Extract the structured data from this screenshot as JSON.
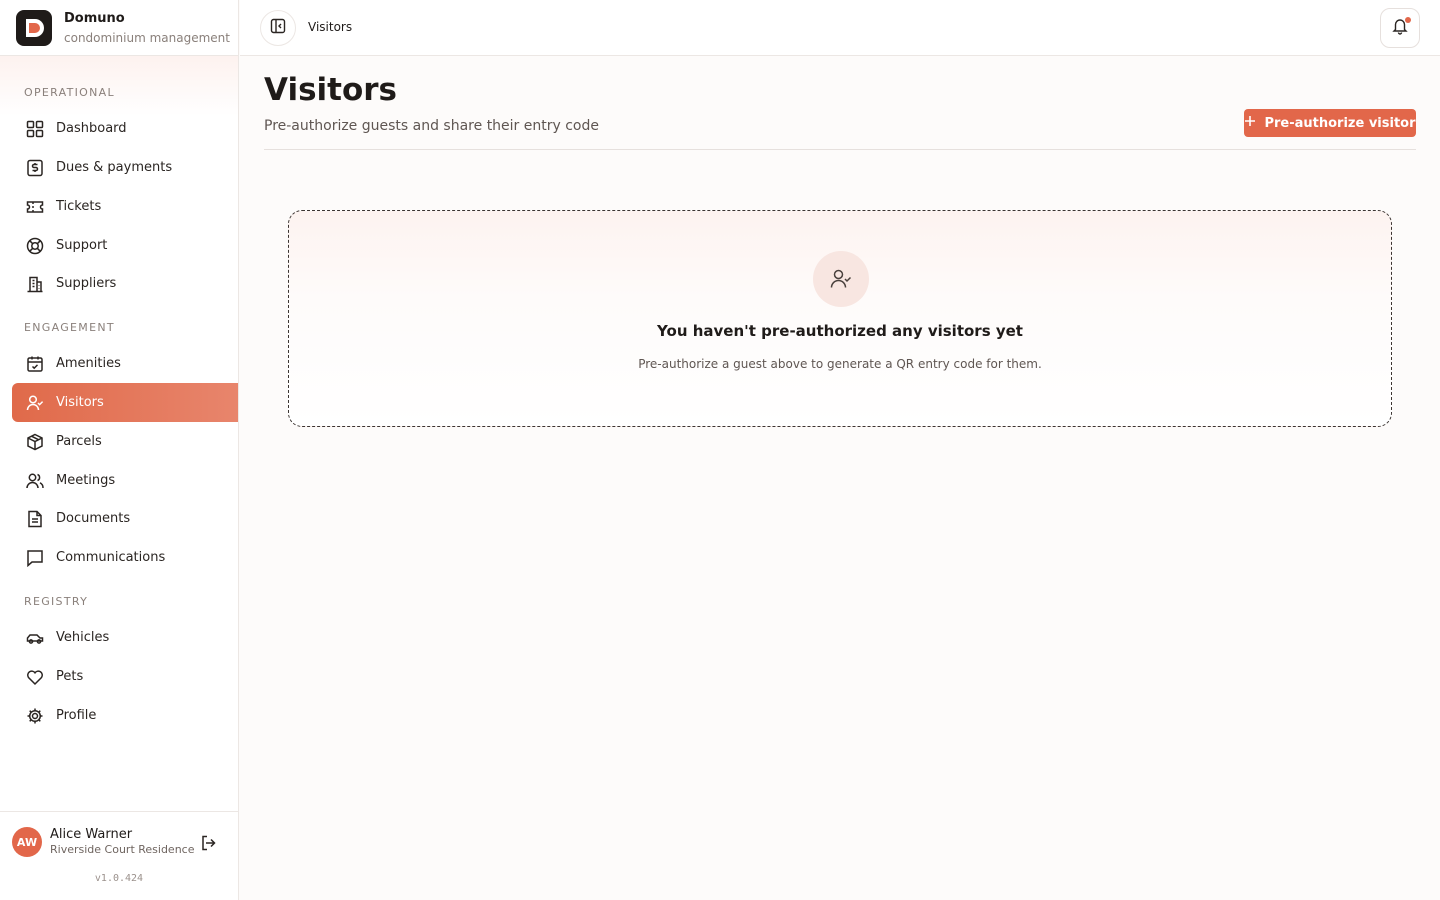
{
  "brand": {
    "name": "Domuno",
    "subtitle": "condominium management"
  },
  "sidebar": {
    "sections": [
      {
        "label": "OPERATIONAL"
      },
      {
        "label": "ENGAGEMENT"
      },
      {
        "label": "REGISTRY"
      }
    ],
    "items": [
      {
        "label": "Dashboard",
        "icon": "grid-icon"
      },
      {
        "label": "Dues & payments",
        "icon": "dollar-receipt-icon"
      },
      {
        "label": "Tickets",
        "icon": "ticket-icon"
      },
      {
        "label": "Support",
        "icon": "lifebuoy-icon"
      },
      {
        "label": "Suppliers",
        "icon": "building-icon"
      },
      {
        "label": "Amenities",
        "icon": "calendar-check-icon"
      },
      {
        "label": "Visitors",
        "icon": "user-check-icon",
        "active": true
      },
      {
        "label": "Parcels",
        "icon": "package-icon"
      },
      {
        "label": "Meetings",
        "icon": "users-icon"
      },
      {
        "label": "Documents",
        "icon": "document-icon"
      },
      {
        "label": "Communications",
        "icon": "message-icon"
      },
      {
        "label": "Vehicles",
        "icon": "car-icon"
      },
      {
        "label": "Pets",
        "icon": "heart-icon"
      },
      {
        "label": "Profile",
        "icon": "gear-icon"
      }
    ]
  },
  "user": {
    "initials": "AW",
    "name": "Alice Warner",
    "org": "Riverside Court Residence",
    "version": "v1.0.424"
  },
  "topbar": {
    "breadcrumb": "Visitors"
  },
  "main": {
    "title": "Visitors",
    "subtitle": "Pre-authorize guests and share their entry code",
    "primary_button": "Pre-authorize visitor",
    "empty_state": {
      "title": "You haven't pre-authorized any visitors yet",
      "description": "Pre-authorize a guest above to generate a QR entry code for them."
    }
  },
  "colors": {
    "accent": "#e2674a",
    "text": "#1f1b19",
    "muted": "#8a807b"
  }
}
